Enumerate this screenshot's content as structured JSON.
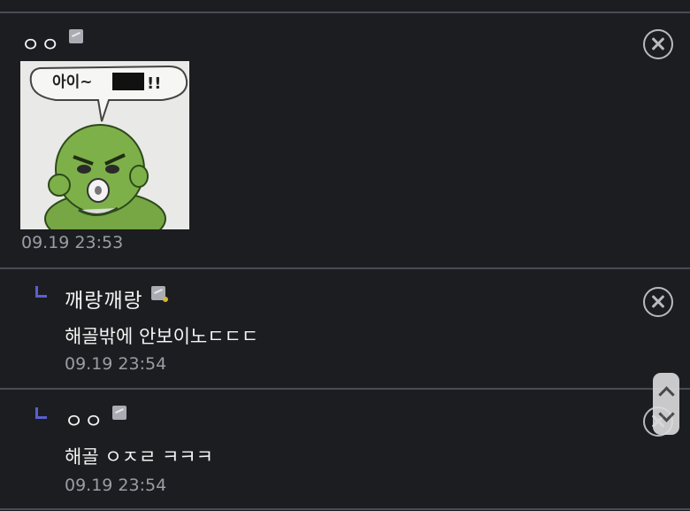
{
  "comments": [
    {
      "author": "ㅇㅇ",
      "image_caption": "아이~",
      "timestamp": "09.19 23:53"
    },
    {
      "author": "깨랑깨랑",
      "text": "해골밖에 안보이노ㄷㄷㄷ",
      "timestamp": "09.19 23:54"
    },
    {
      "author": "ㅇㅇ",
      "text": "해골 ㅇㅈㄹ ㅋㅋㅋ",
      "timestamp": "09.19 23:54"
    }
  ],
  "icons": {
    "close": "close-circle-icon",
    "badge": "member-badge-icon",
    "reply": "reply-arrow-icon",
    "scroll_up": "chevron-up-icon",
    "scroll_down": "chevron-down-icon"
  },
  "colors": {
    "background": "#1c1d20",
    "divider": "#4a4b56",
    "reply_mark": "#5a5fcf",
    "timestamp": "#9c9ca4"
  }
}
